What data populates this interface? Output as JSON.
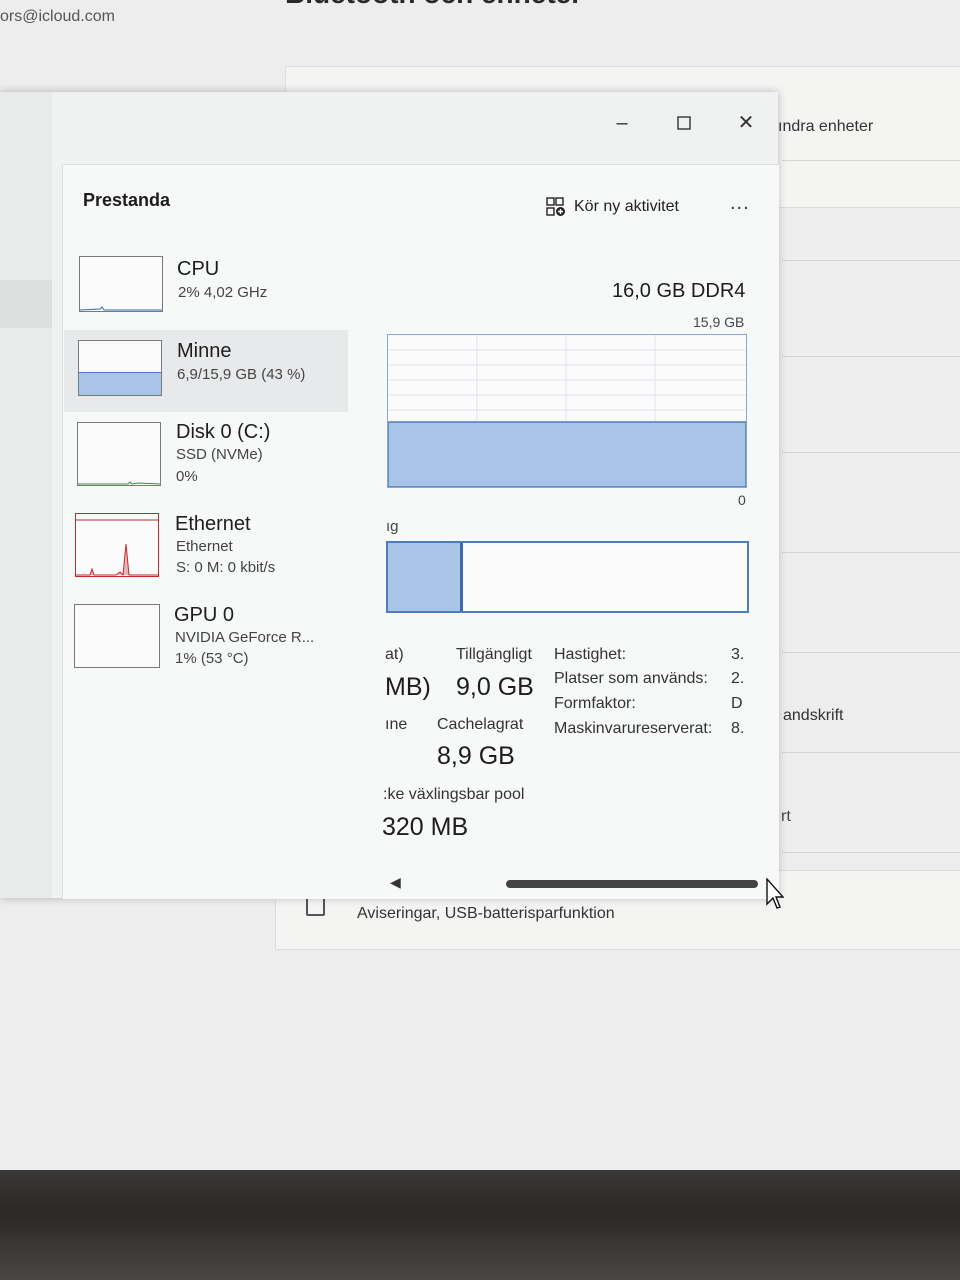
{
  "background": {
    "email": "ors@icloud.com",
    "title": "Bluetooth och enheter",
    "other_devices": "ındra enheter",
    "handwriting": "andskrift",
    "fragment": "rt",
    "notify_label": "Aviseringar, USB-batterisparfunktion"
  },
  "window": {
    "min_glyph": "–",
    "max_glyph": "☐",
    "close_glyph": "✕"
  },
  "header": {
    "title": "Prestanda",
    "run_task": "Kör ny aktivitet",
    "more": "..."
  },
  "devices": [
    {
      "name": "CPU",
      "sub1": "2% 4,02 GHz",
      "sub2": ""
    },
    {
      "name": "Minne",
      "sub1": "6,9/15,9 GB (43 %)",
      "sub2": ""
    },
    {
      "name": "Disk 0 (C:)",
      "sub1": "SSD (NVMe)",
      "sub2": "0%"
    },
    {
      "name": "Ethernet",
      "sub1": "Ethernet",
      "sub2": "S: 0 M: 0 kbit/s"
    },
    {
      "name": "GPU 0",
      "sub1": "NVIDIA GeForce R...",
      "sub2": "1% (53 °C)"
    }
  ],
  "memory": {
    "capacity": "16,0 GB DDR4",
    "max_label": "15,9 GB",
    "min_label": "0",
    "usage_fraction": 0.43,
    "composition_label": "ıg",
    "composition_used_fraction": 0.2
  },
  "stats": {
    "in_use_label_frag": "at)",
    "in_use_value_frag": "MB)",
    "available_label": "Tillgängligt",
    "available_value": "9,0 GB",
    "committed_label_frag": "ıne",
    "cached_label": "Cachelagrat",
    "cached_value": "8,9 GB",
    "nonpaged_label_frag": ":ke växlingsbar pool",
    "nonpaged_value_frag": "320 MB",
    "speed_label": "Hastighet:",
    "speed_value": "3.",
    "slots_label": "Platser som används:",
    "slots_value": "2.",
    "form_label": "Formfaktor:",
    "form_value": "D",
    "reserved_label": "Maskinvarureserverat:",
    "reserved_value": "8."
  },
  "colors": {
    "memory_fill": "#a8c4e6",
    "memory_border": "#4f7bbf",
    "ethernet": "#c22b2b"
  }
}
